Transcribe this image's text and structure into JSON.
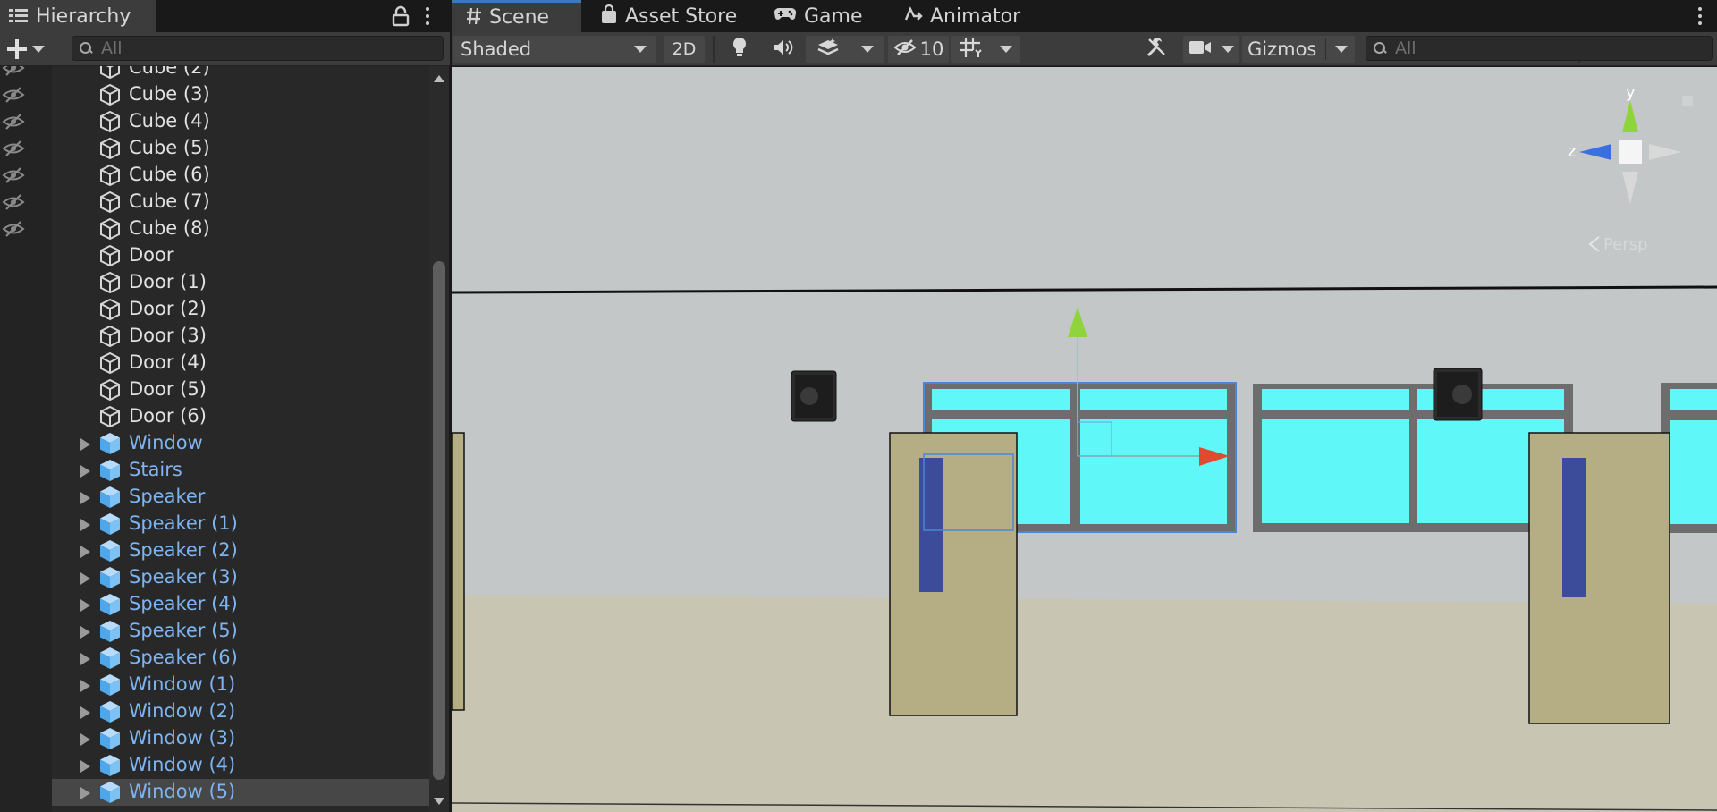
{
  "hierarchy": {
    "tab_label": "Hierarchy",
    "search_placeholder": "All",
    "items": [
      {
        "name": "Cube (2)",
        "kind": "plain",
        "hidden": true
      },
      {
        "name": "Cube (3)",
        "kind": "plain",
        "hidden": true
      },
      {
        "name": "Cube (4)",
        "kind": "plain",
        "hidden": true
      },
      {
        "name": "Cube (5)",
        "kind": "plain",
        "hidden": true
      },
      {
        "name": "Cube (6)",
        "kind": "plain",
        "hidden": true
      },
      {
        "name": "Cube (7)",
        "kind": "plain",
        "hidden": true
      },
      {
        "name": "Cube (8)",
        "kind": "plain",
        "hidden": true
      },
      {
        "name": "Door",
        "kind": "plain",
        "hidden": false
      },
      {
        "name": "Door (1)",
        "kind": "plain",
        "hidden": false
      },
      {
        "name": "Door (2)",
        "kind": "plain",
        "hidden": false
      },
      {
        "name": "Door (3)",
        "kind": "plain",
        "hidden": false
      },
      {
        "name": "Door (4)",
        "kind": "plain",
        "hidden": false
      },
      {
        "name": "Door (5)",
        "kind": "plain",
        "hidden": false
      },
      {
        "name": "Door (6)",
        "kind": "plain",
        "hidden": false
      },
      {
        "name": "Window",
        "kind": "prefab",
        "hidden": false
      },
      {
        "name": "Stairs",
        "kind": "prefab",
        "hidden": false
      },
      {
        "name": "Speaker",
        "kind": "prefab",
        "hidden": false
      },
      {
        "name": "Speaker (1)",
        "kind": "prefab",
        "hidden": false
      },
      {
        "name": "Speaker (2)",
        "kind": "prefab",
        "hidden": false
      },
      {
        "name": "Speaker (3)",
        "kind": "prefab",
        "hidden": false
      },
      {
        "name": "Speaker (4)",
        "kind": "prefab",
        "hidden": false
      },
      {
        "name": "Speaker (5)",
        "kind": "prefab",
        "hidden": false
      },
      {
        "name": "Speaker (6)",
        "kind": "prefab",
        "hidden": false
      },
      {
        "name": "Window (1)",
        "kind": "prefab",
        "hidden": false
      },
      {
        "name": "Window (2)",
        "kind": "prefab",
        "hidden": false
      },
      {
        "name": "Window (3)",
        "kind": "prefab",
        "hidden": false
      },
      {
        "name": "Window (4)",
        "kind": "prefab",
        "hidden": false
      },
      {
        "name": "Window (5)",
        "kind": "prefab",
        "hidden": false,
        "selected": true
      }
    ]
  },
  "tabs": [
    {
      "label": "Scene",
      "icon": "hash-icon",
      "active": true
    },
    {
      "label": "Asset Store",
      "icon": "shopping-bag-icon"
    },
    {
      "label": "Game",
      "icon": "gamepad-icon"
    },
    {
      "label": "Animator",
      "icon": "animator-icon"
    }
  ],
  "scene_toolbar": {
    "draw_mode": "Shaded",
    "toggle_2d": "2D",
    "hidden_count": "10",
    "gizmos": "Gizmos",
    "search_placeholder": "All"
  },
  "view_gizmo": {
    "y_label": "y",
    "z_label": "z",
    "projection": "Persp"
  },
  "colors": {
    "prefab_text": "#7eb4f0",
    "window_glass": "#5ff7f8",
    "axis_x": "#e04a2f",
    "axis_y": "#8fd43c",
    "axis_z": "#3a6fe0",
    "door": "#b5ad84",
    "floor": "#c8c5b3",
    "wall": "#c4c7c8"
  }
}
